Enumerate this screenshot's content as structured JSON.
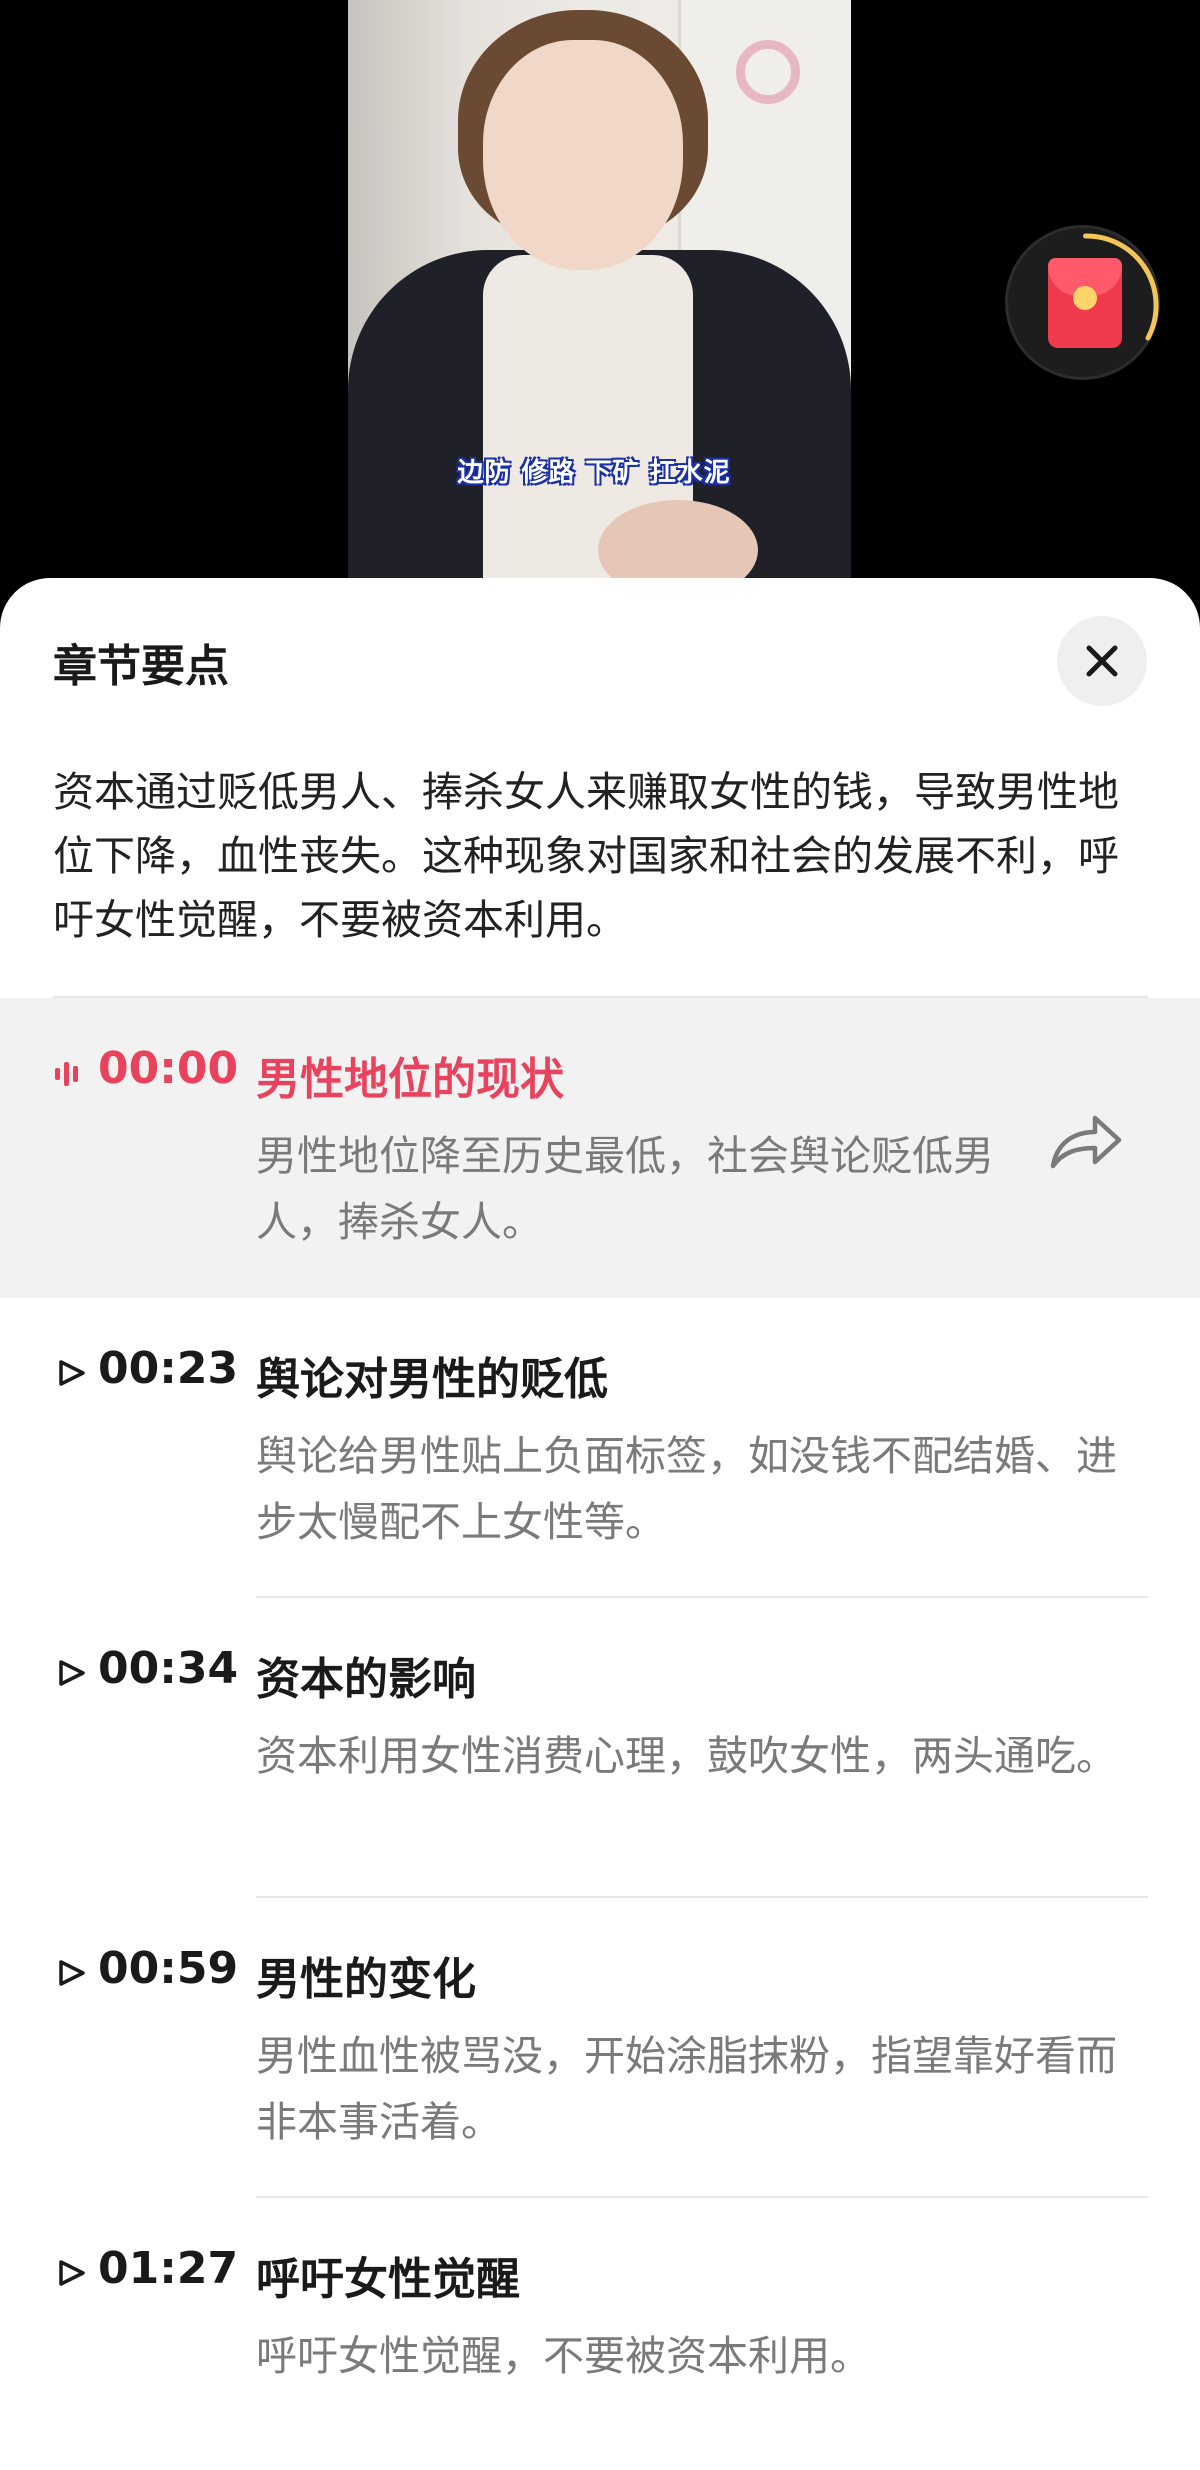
{
  "video": {
    "subtitle": "边防 修路 下矿 扛水泥"
  },
  "sheet": {
    "title": "章节要点",
    "summary": "资本通过贬低男人、捧杀女人来赚取女性的钱，导致男性地位下降，血性丧失。这种现象对国家和社会的发展不利，呼吁女性觉醒，不要被资本利用。",
    "chapters": [
      {
        "time": "00:00",
        "title": "男性地位的现状",
        "desc": "男性地位降至历史最低，社会舆论贬低男人，捧杀女人。",
        "active": true
      },
      {
        "time": "00:23",
        "title": "舆论对男性的贬低",
        "desc": "舆论给男性贴上负面标签，如没钱不配结婚、进步太慢配不上女性等。"
      },
      {
        "time": "00:34",
        "title": "资本的影响",
        "desc": "资本利用女性消费心理，鼓吹女性，两头通吃。"
      },
      {
        "time": "00:59",
        "title": "男性的变化",
        "desc": "男性血性被骂没，开始涂脂抹粉，指望靠好看而非本事活着。"
      },
      {
        "time": "01:27",
        "title": "呼吁女性觉醒",
        "desc": "呼吁女性觉醒，不要被资本利用。"
      }
    ]
  },
  "icons": {
    "close": "close-icon",
    "share": "share-arrow-icon",
    "playing": "audio-bars-icon",
    "play": "play-triangle-icon",
    "red_packet": "red-envelope-icon"
  },
  "colors": {
    "accent": "#e8425d",
    "active_row_bg": "#f2f2f2",
    "desc_text": "#7a7a7a",
    "red_packet": "#f03b4f"
  }
}
